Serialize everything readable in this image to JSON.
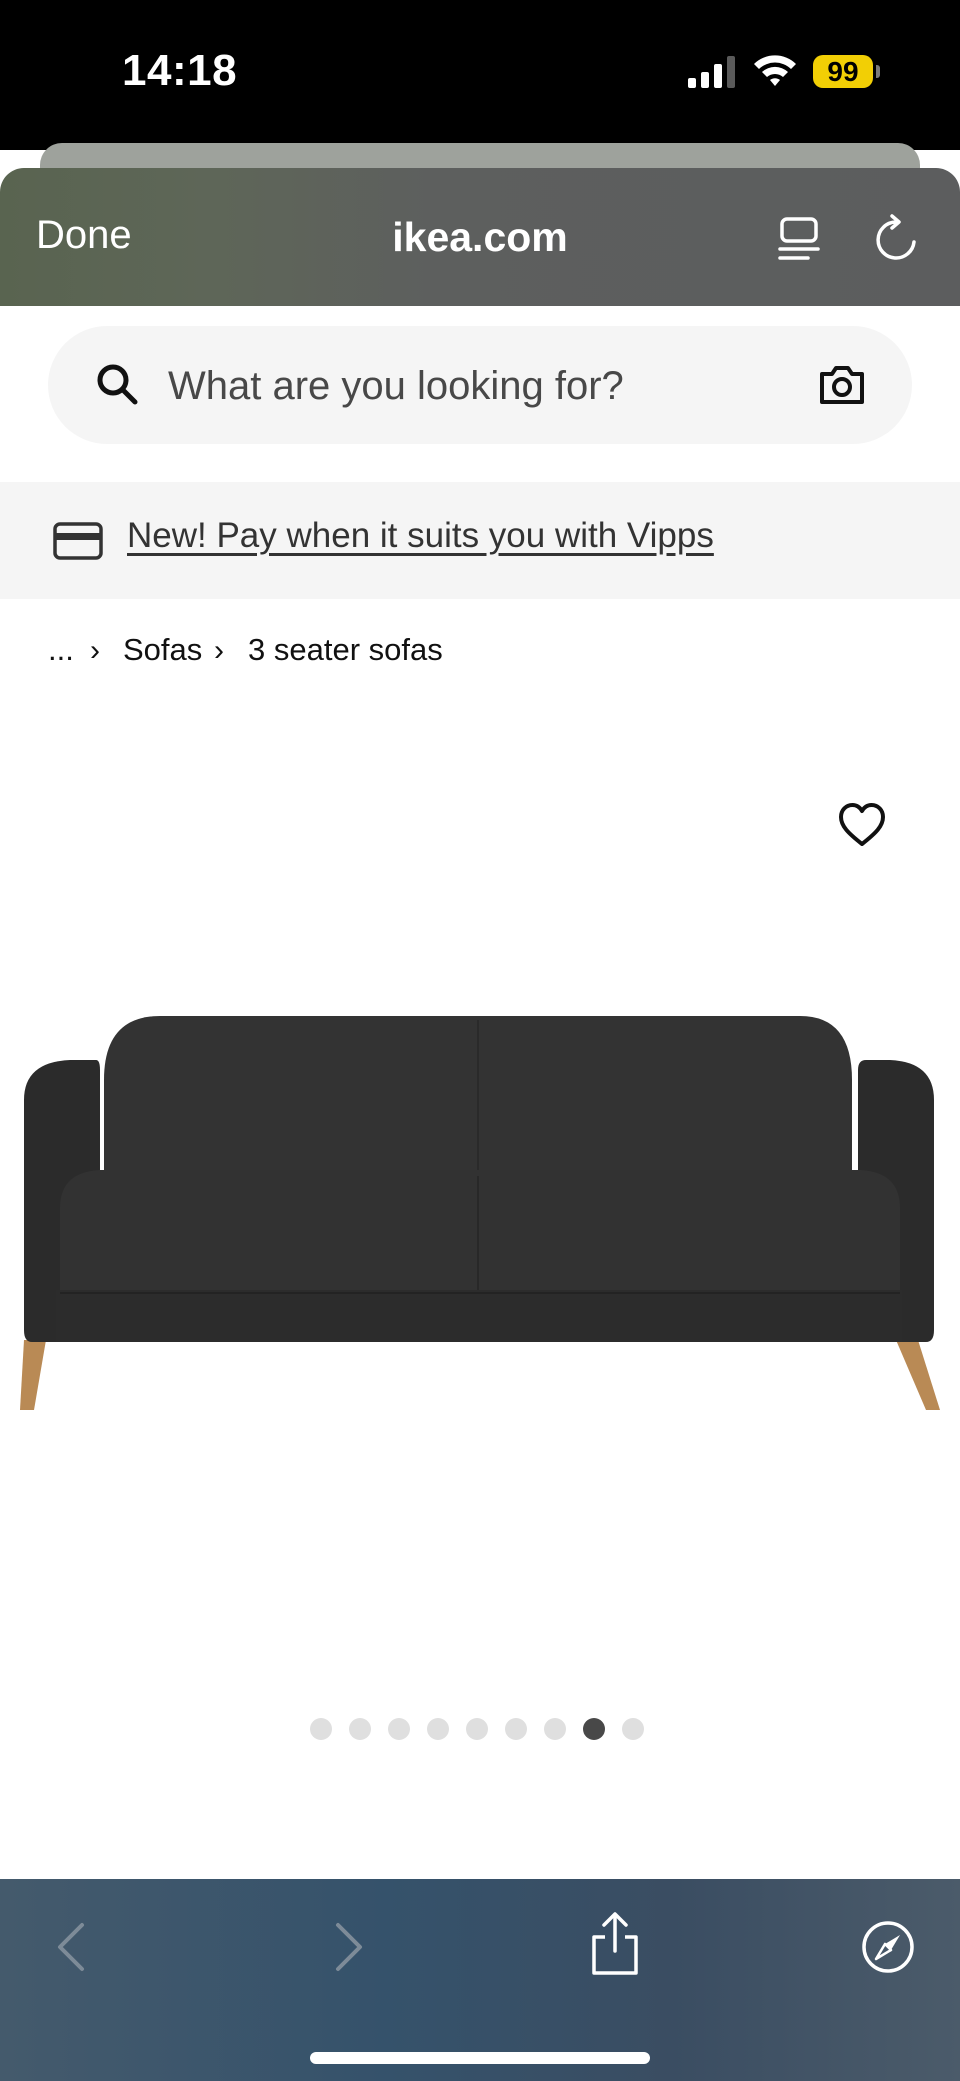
{
  "status_bar": {
    "time": "14:18",
    "battery": "99",
    "icons": [
      "signal-icon",
      "wifi-icon",
      "battery-icon"
    ],
    "battery_color": "#f2cf05"
  },
  "browser": {
    "done_label": "Done",
    "url": "ikea.com",
    "icons": [
      "reader-icon",
      "reload-icon"
    ]
  },
  "search": {
    "placeholder": "What are you looking for?",
    "icons": [
      "search-icon",
      "camera-icon"
    ]
  },
  "promo": {
    "text": "New! Pay when it suits you with Vipps",
    "icon": "card-icon"
  },
  "breadcrumb": {
    "items": [
      "...",
      "Sofas",
      "3 seater sofas"
    ],
    "separator": "›"
  },
  "product": {
    "favorite_icon": "heart-icon",
    "image": "dark-grey-3-seater-sofa",
    "sofa_color": "#2e2e2e",
    "leg_color": "#b98a55"
  },
  "carousel": {
    "total": 9,
    "active_index": 7,
    "active_color": "#484848",
    "inactive_color": "#dfdfdf"
  },
  "bottom_toolbar": {
    "icons": [
      "back-arrow-icon",
      "forward-arrow-icon",
      "share-icon",
      "compass-icon"
    ]
  }
}
